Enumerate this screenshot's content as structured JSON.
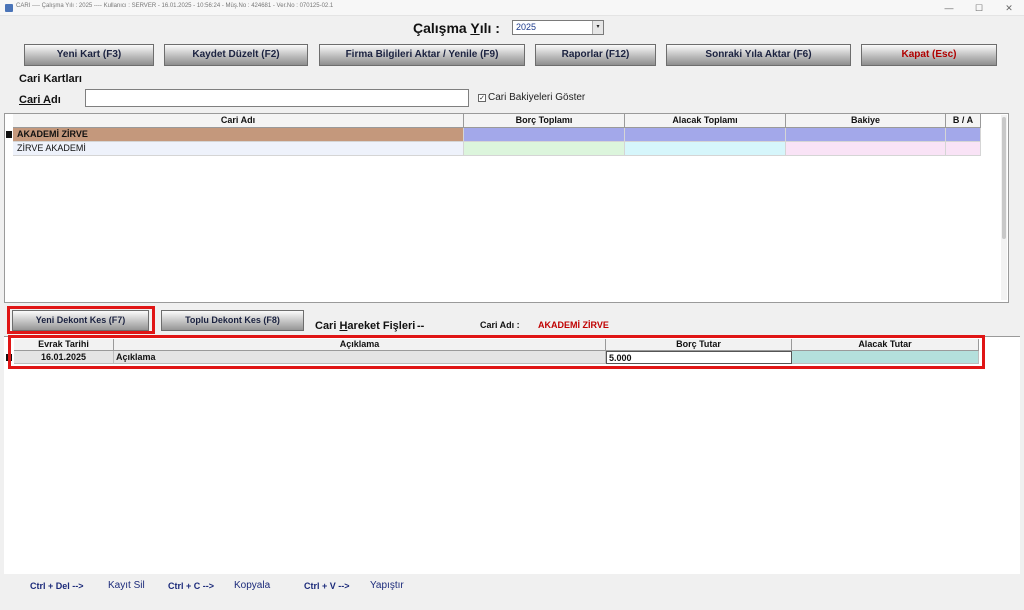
{
  "titlebar": {
    "title": "CARI  ----  Çalışma Yılı : 2025   ----  Kullanıcı : SERVER  -  16.01.2025  -  10:56:24  -  Müş.No : 424681  -  Ver.No : 070125-02.1",
    "min": "—",
    "max": "☐",
    "close": "✕"
  },
  "year": {
    "label_pre": "Çalışma ",
    "label_u": "Y",
    "label_post": "ılı :",
    "value": "2025"
  },
  "toolbar": {
    "new_card": "Yeni Kart (F3)",
    "save_edit": "Kaydet Düzelt (F2)",
    "company_transfer": "Firma Bilgileri Aktar / Yenile (F9)",
    "reports": "Raporlar (F12)",
    "next_year": "Sonraki Yıla Aktar (F6)",
    "close": "Kapat (Esc)"
  },
  "cards": {
    "section_title": "Cari Kartları",
    "name_label_u": "Cari ",
    "name_label_u2": "A",
    "name_label_post": "dı",
    "name_value": "",
    "show_balances_check": "✓",
    "show_balances": "Cari Bakiyeleri Göster",
    "columns": [
      "Cari Adı",
      "Borç Toplamı",
      "Alacak Toplamı",
      "Bakiye",
      "B / A"
    ],
    "rows": [
      {
        "name": "AKADEMİ ZİRVE",
        "debit": "",
        "credit": "",
        "balance": "",
        "ba": ""
      },
      {
        "name": "ZİRVE AKADEMİ",
        "debit": "",
        "credit": "",
        "balance": "",
        "ba": ""
      }
    ]
  },
  "movements": {
    "new_receipt": "Yeni Dekont Kes (F7)",
    "bulk_receipt": "Toplu Dekont Kes (F8)",
    "title_pre": "Cari ",
    "title_u": "H",
    "title_post": "areket Fişleri",
    "separator": "--",
    "cari_label": "Cari Adı :",
    "cari_value": "AKADEMİ ZİRVE",
    "columns": [
      "Evrak Tarihi",
      "Açıklama",
      "Borç Tutar",
      "Alacak Tutar"
    ],
    "rows": [
      {
        "date": "16.01.2025",
        "desc": "Açıklama",
        "debit": "5.000",
        "credit": ""
      }
    ]
  },
  "shortcuts": [
    {
      "key": "Ctrl + Del -->",
      "action": "Kayıt Sil"
    },
    {
      "key": "Ctrl + C -->",
      "action": "Kopyala"
    },
    {
      "key": "Ctrl + V -->",
      "action": "Yapıştır"
    }
  ],
  "colors": {
    "highlight_box": "#e01515",
    "row_selected": "#c4987c",
    "row_selected_value": "#a3a8ea",
    "close_text": "#b00000",
    "cari_value": "#c00000"
  }
}
